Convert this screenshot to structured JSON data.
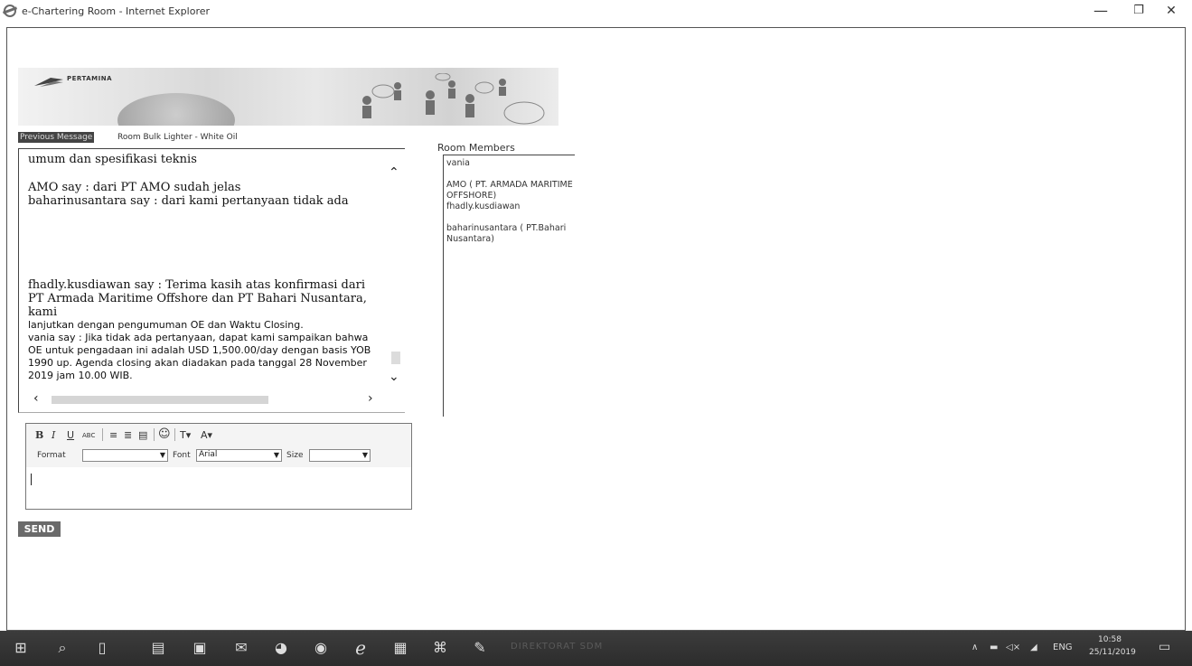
{
  "window": {
    "title": "e-Chartering Room - Internet Explorer",
    "minimize": "—",
    "maximize": "❐",
    "close": "✕"
  },
  "banner": {
    "brand": "PERTAMINA"
  },
  "tabs": {
    "previous": "Previous Message",
    "room": "Room Bulk Lighter - White Oil"
  },
  "messages": [
    {
      "text": "umum dan spesifikasi teknis",
      "style": "serif"
    },
    {
      "text": "AMO say : dari PT AMO sudah jelas",
      "style": "serif"
    },
    {
      "text": "baharinusantara say : dari kami pertanyaan tidak ada",
      "style": "serif"
    },
    {
      "text": "fhadly.kusdiawan say : Terima kasih atas konfirmasi dari PT Armada Maritime Offshore dan PT Bahari Nusantara, kami",
      "style": "serif"
    },
    {
      "text": "lanjutkan dengan pengumuman OE dan Waktu Closing.",
      "style": "sans"
    },
    {
      "text": "vania say : Jika tidak ada pertanyaan, dapat kami sampaikan bahwa OE untuk pengadaan ini adalah USD 1,500.00/day dengan basis YOB 1990 up. Agenda closing akan diadakan pada tanggal 28 November 2019 jam 10.00 WIB.",
      "style": "sans"
    }
  ],
  "members": {
    "label": "Room Members",
    "items": [
      "vania",
      "AMO ( PT. ARMADA MARITIME OFFSHORE)",
      "fhadly.kusdiawan",
      "baharinusantara ( PT.Bahari Nusantara)"
    ]
  },
  "editor": {
    "bold": "B",
    "italic": "I",
    "underline": "U",
    "strike": "ABC",
    "format_label": "Format",
    "format_value": "",
    "font_label": "Font",
    "font_value": "Arial",
    "size_label": "Size",
    "size_value": "",
    "text_color": "T",
    "bg_color": "A"
  },
  "send_label": "SEND",
  "taskbar": {
    "faded_text": "DIREKTORAT SDM",
    "lang": "ENG",
    "time": "10:58",
    "date": "25/11/2019"
  }
}
